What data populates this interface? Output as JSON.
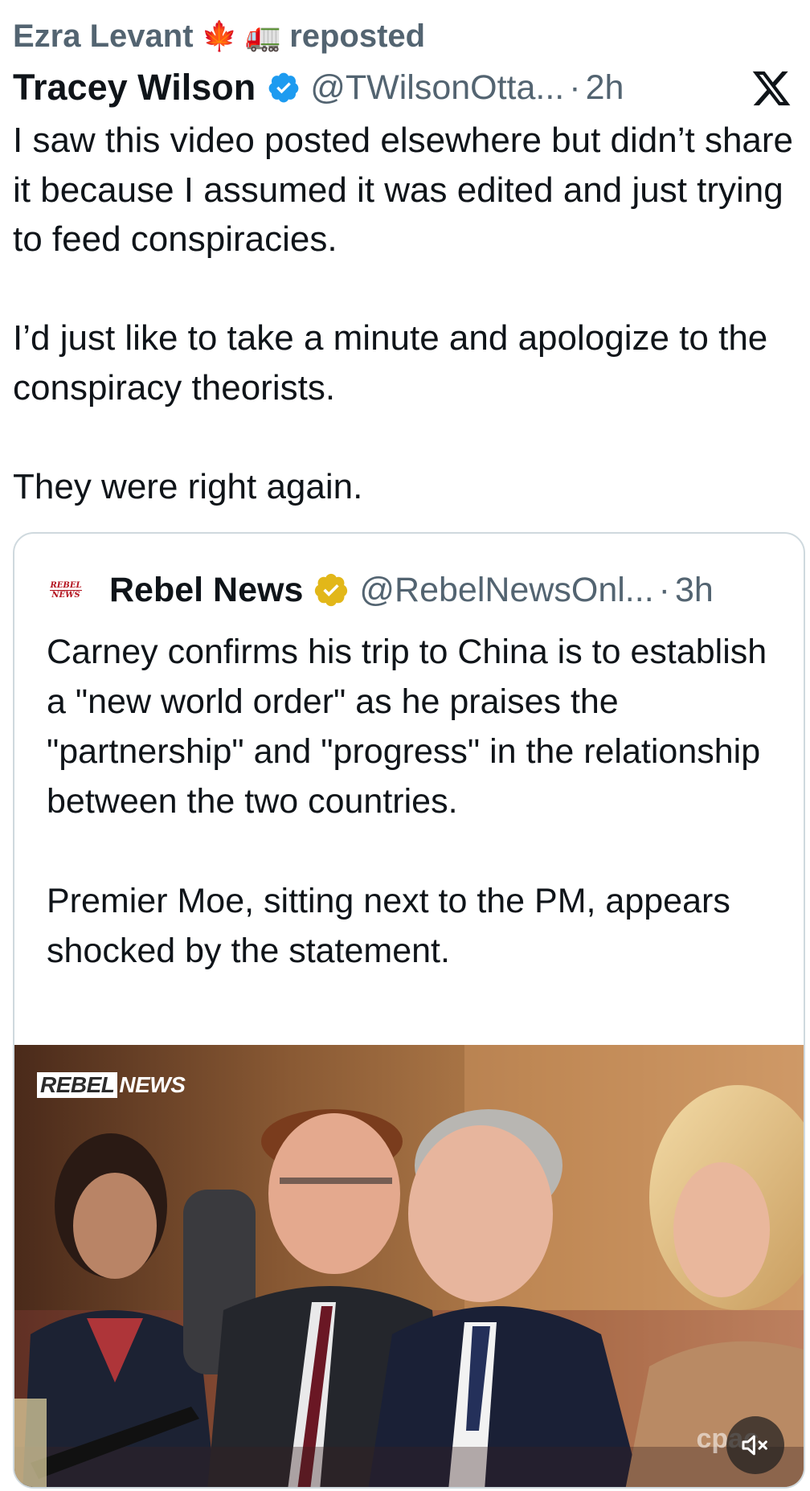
{
  "repost": {
    "user": "Ezra Levant",
    "emoji_1": "🍁",
    "emoji_2": "🚛",
    "label": "reposted"
  },
  "tweet": {
    "author": "Tracey Wilson",
    "handle": "@TWilsonOtta...",
    "separator": "·",
    "time": "2h",
    "paragraphs": [
      "I saw this video posted elsewhere but didn’t share it because I assumed it was edited and just trying to feed conspiracies.",
      "I’d just like to take a minute and apologize to the conspiracy theorists.",
      "They were right again."
    ]
  },
  "quote": {
    "avatar_text": [
      "REBEL",
      "NEWS"
    ],
    "author": "Rebel News",
    "handle": "@RebelNewsOnl...",
    "separator": "·",
    "time": "3h",
    "paragraphs": [
      "Carney confirms his trip to China is to establish a \"new world order\" as he praises the \"partnership\" and \"progress\" in the relationship between the two countries.",
      "Premier Moe, sitting next to the PM, appears shocked by the statement."
    ],
    "video": {
      "watermark_a": "REBEL",
      "watermark_b": "NEWS",
      "corner_logo": "cpac"
    }
  },
  "icons": {
    "verified_blue": "verified-badge-blue-icon",
    "verified_gold": "verified-badge-gold-icon",
    "x_logo": "x-logo-icon",
    "mute": "speaker-muted-icon"
  },
  "colors": {
    "text_primary": "#0f1419",
    "text_secondary": "#536471",
    "verified_blue": "#1d9bf0",
    "verified_gold": "#e2b719",
    "card_border": "#cfd9de"
  }
}
